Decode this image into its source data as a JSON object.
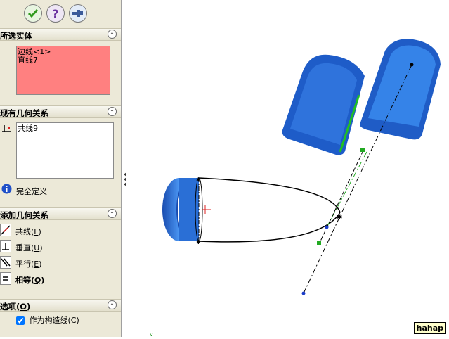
{
  "toolbar": {
    "ok_icon": "checkmark-icon",
    "help_label": "?",
    "pin_icon": "pushpin-icon"
  },
  "selected_entities": {
    "title": "所选实体",
    "items": [
      "边线<1>",
      "直线7"
    ]
  },
  "existing_relations": {
    "title": "现有几何关系",
    "items": [
      "共线9"
    ],
    "status": "完全定义"
  },
  "add_relations": {
    "title": "添加几何关系",
    "items": [
      {
        "label": "共线",
        "hotkey": "L",
        "icon": "collinear-icon",
        "bold": false
      },
      {
        "label": "垂直",
        "hotkey": "U",
        "icon": "perpendicular-icon",
        "bold": false
      },
      {
        "label": "平行",
        "hotkey": "E",
        "icon": "parallel-icon",
        "bold": false
      },
      {
        "label": "相等",
        "hotkey": "Q",
        "icon": "equal-icon",
        "bold": true
      }
    ]
  },
  "options": {
    "title": "选项",
    "hotkey": "O",
    "construction_label": "作为构造线",
    "construction_hotkey": "C",
    "construction_checked": true
  },
  "watermark": "hahap",
  "colors": {
    "panel_bg": "#ece9d8",
    "selection_pink": "#ff8080",
    "model_blue": "#2a6fd6",
    "highlight_green": "#22c022"
  }
}
